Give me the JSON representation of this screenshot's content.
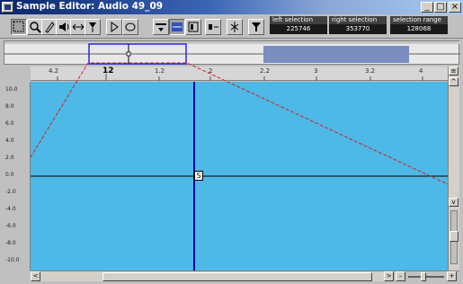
{
  "window": {
    "title": "Sample Editor: Audio 49_09",
    "minimize_label": "_",
    "maximize_label": "□",
    "close_label": "×"
  },
  "toolbar": {
    "tools": [
      {
        "name": "range-selection-tool",
        "glyph": "⬚",
        "active": true
      },
      {
        "name": "zoom-tool",
        "glyph": "🔍"
      },
      {
        "name": "draw-tool",
        "glyph": "✎"
      },
      {
        "name": "speaker-tool",
        "glyph": "◁"
      },
      {
        "name": "scrub-tool",
        "glyph": "⇆"
      },
      {
        "name": "audio-snap-tool",
        "glyph": "▼"
      }
    ],
    "left_selection": {
      "label": "left selection",
      "value": "225746"
    },
    "right_selection": {
      "label": "right selection",
      "value": "353770"
    },
    "selection_range": {
      "label": "selection range",
      "value": "128068"
    }
  },
  "ruler": {
    "ticks": [
      {
        "label": "4.2",
        "bold": false
      },
      {
        "label": "12",
        "bold": true
      },
      {
        "label": "1.2",
        "bold": false
      },
      {
        "label": "2",
        "bold": false
      },
      {
        "label": "2.2",
        "bold": false
      },
      {
        "label": "3",
        "bold": false
      },
      {
        "label": "3.2",
        "bold": false
      },
      {
        "label": "4",
        "bold": false
      }
    ],
    "menu_label": "≡"
  },
  "scale": {
    "labels": [
      "10.0",
      "8.0",
      "6.0",
      "4.0",
      "2.0",
      "0.0",
      "-2.0",
      "-4.0",
      "-6.0",
      "-8.0",
      "-10.0"
    ]
  },
  "waveform": {
    "background": "#4eb8e6",
    "zero_line_color": "#000000",
    "cursor_color": "#0000aa",
    "envelope_color": "#cc2222",
    "selection_color": "#3333cc",
    "snap_point_label": "S"
  },
  "hscroll": {
    "left_arrow": "<",
    "right_arrow": ">"
  },
  "vscroll": {
    "up_arrow": "^",
    "down_arrow": "v"
  },
  "zoom": {
    "minus": "–",
    "plus": "+"
  }
}
